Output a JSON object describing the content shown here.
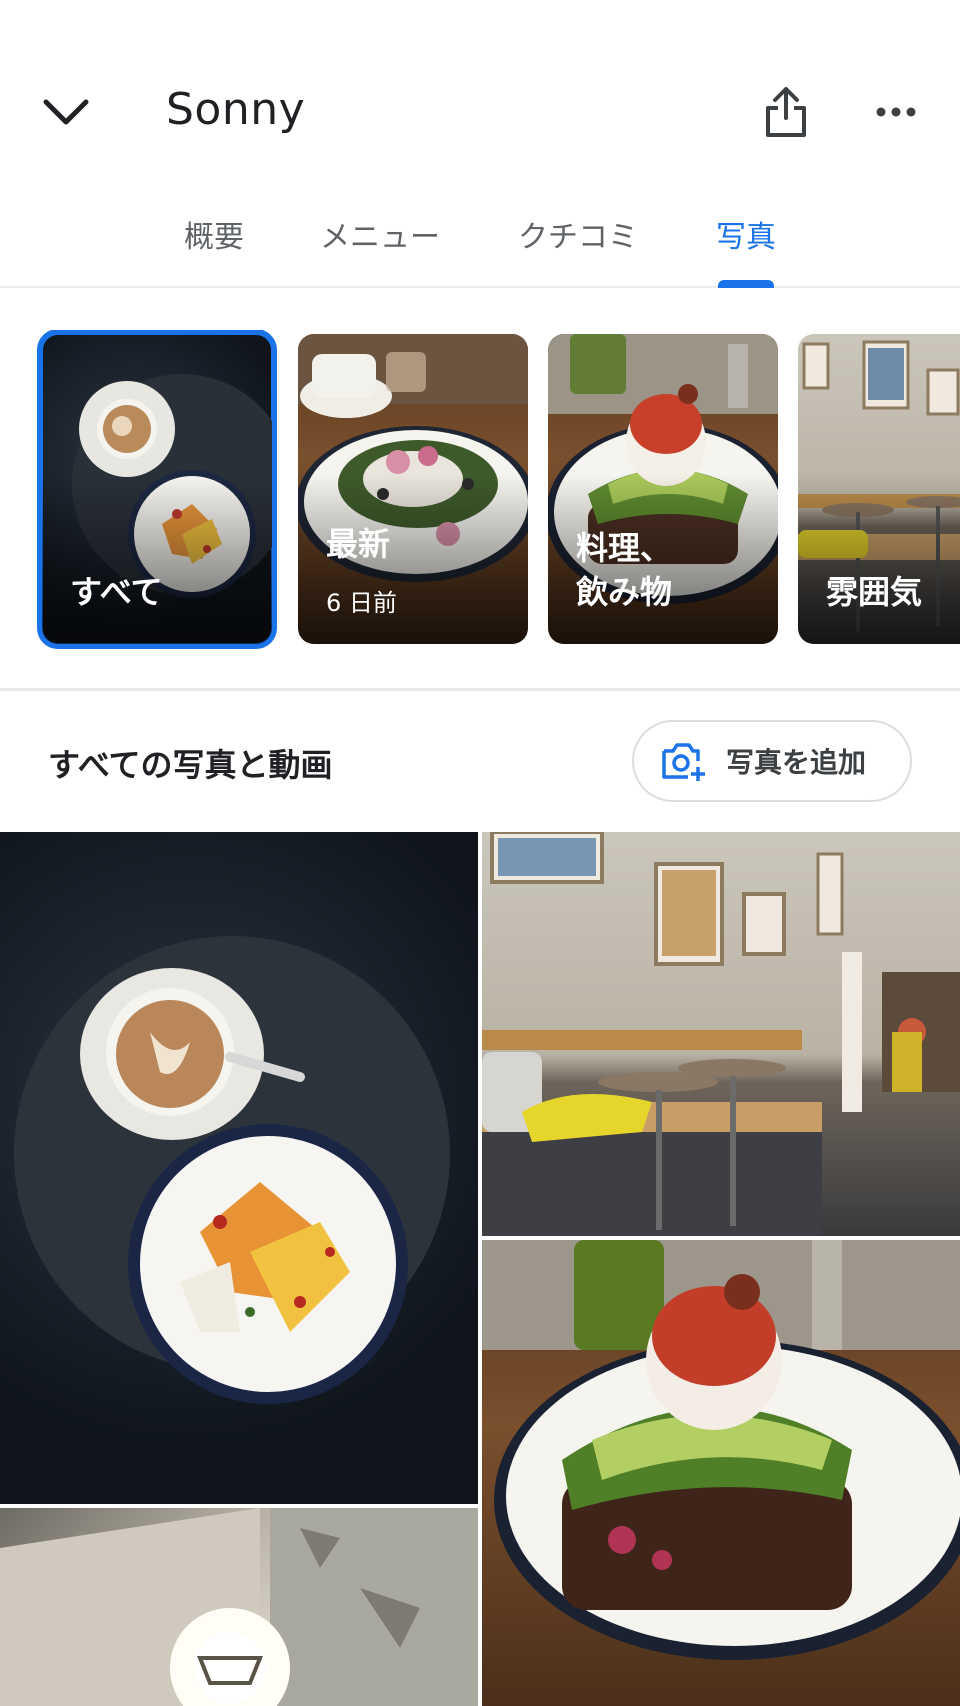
{
  "header": {
    "title": "Sonny",
    "back_icon": "chevron-down-icon",
    "share_icon": "share-icon",
    "more_icon": "more-horizontal-icon"
  },
  "tabs": [
    {
      "label": "概要",
      "active": false
    },
    {
      "label": "メニュー",
      "active": false
    },
    {
      "label": "クチコミ",
      "active": false
    },
    {
      "label": "写真",
      "active": true
    }
  ],
  "categories": [
    {
      "label": "すべて",
      "sub": "",
      "selected": true
    },
    {
      "label": "最新",
      "sub": "6 日前",
      "selected": false
    },
    {
      "label": "料理、\n飲み物",
      "sub": "",
      "selected": false
    },
    {
      "label": "雰囲気",
      "sub": "",
      "selected": false
    }
  ],
  "section": {
    "title": "すべての写真と動画",
    "add_photo_label": "写真を追加",
    "add_photo_icon": "add-photo-camera-icon"
  },
  "colors": {
    "accent": "#1a73e8",
    "text": "#202124",
    "muted": "#5f6368"
  }
}
